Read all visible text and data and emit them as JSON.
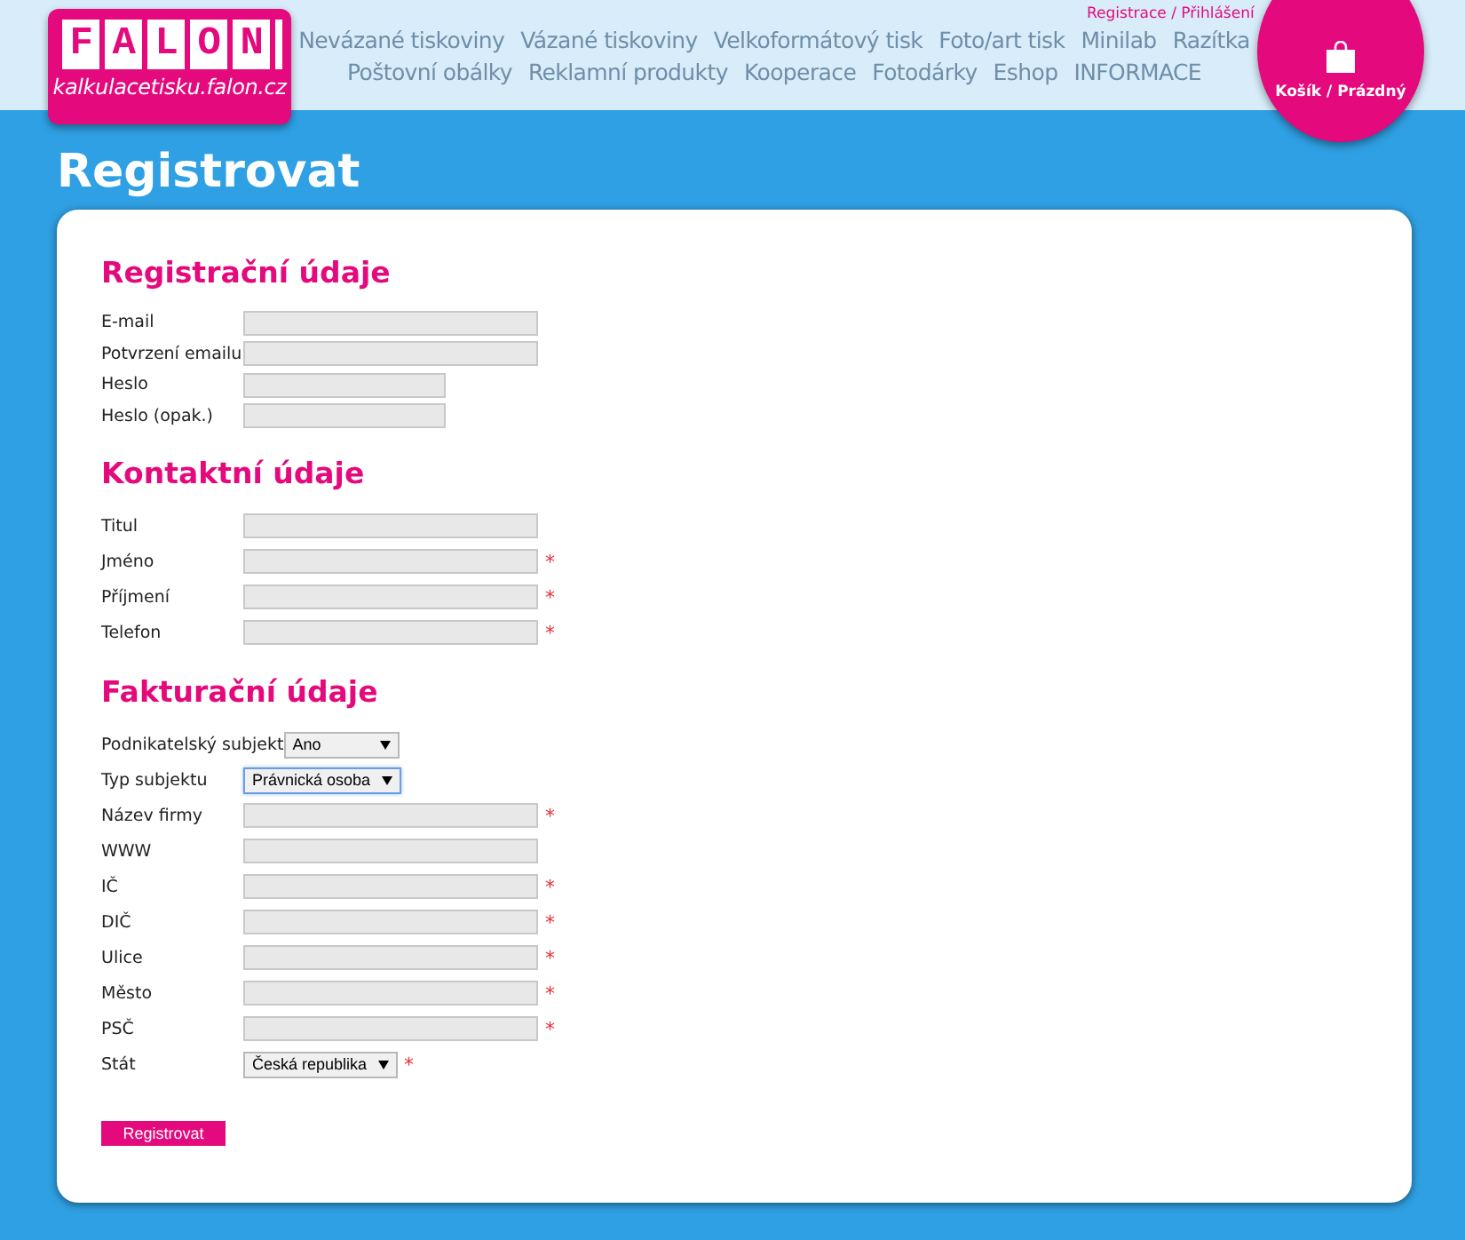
{
  "header": {
    "logo": {
      "letters": "FALON",
      "url": "kalkulacetisku.falon.cz"
    },
    "account_link": "Registrace / Přihlášení",
    "nav": [
      [
        "Nevázané tiskoviny",
        "Vázané tiskoviny",
        "Velkoformátový tisk",
        "Foto/art tisk",
        "Minilab",
        "Razítka"
      ],
      [
        "Poštovní obálky",
        "Reklamní produkty",
        "Kooperace",
        "Fotodárky",
        "Eshop",
        "INFORMACE"
      ]
    ],
    "cart": {
      "label": "Košík / Prázdný"
    }
  },
  "page_title": "Registrovat",
  "sections": [
    {
      "title": "Registrační údaje",
      "fields": [
        {
          "label": "E-mail",
          "kind": "wide"
        },
        {
          "label": "Potvrzení emailu",
          "kind": "wide"
        },
        {
          "label": "Heslo",
          "kind": "narrow"
        },
        {
          "label": "Heslo (opak.)",
          "kind": "narrow"
        }
      ]
    },
    {
      "title": "Kontaktní údaje",
      "fields": [
        {
          "label": "Titul",
          "kind": "wide"
        },
        {
          "label": "Jméno",
          "kind": "wide",
          "marker": "*"
        },
        {
          "label": "Příjmení",
          "kind": "wide",
          "marker": "*"
        },
        {
          "label": "Telefon",
          "kind": "wide",
          "marker": "*"
        }
      ]
    },
    {
      "title": "Fakturační údaje",
      "fields": [
        {
          "label": "Podnikatelský subjekt",
          "kind": "select",
          "value": "Ano",
          "focused": false
        },
        {
          "label": "Typ subjektu",
          "kind": "select",
          "value": "Právnická osoba",
          "focused": true
        },
        {
          "label": "Název firmy",
          "kind": "wide",
          "marker": "*"
        },
        {
          "label": "WWW",
          "kind": "wide"
        },
        {
          "label": "IČ",
          "kind": "wide",
          "marker": "*"
        },
        {
          "label": "DIČ",
          "kind": "wide",
          "marker": "*"
        },
        {
          "label": "Ulice",
          "kind": "wide",
          "marker": "*"
        },
        {
          "label": "Město",
          "kind": "wide",
          "marker": "*"
        },
        {
          "label": "PSČ",
          "kind": "wide",
          "marker": "*"
        },
        {
          "label": "Stát",
          "kind": "select",
          "value": "Česká republika",
          "focused": false,
          "marker": "*"
        }
      ]
    }
  ],
  "submit": "Registrovat"
}
